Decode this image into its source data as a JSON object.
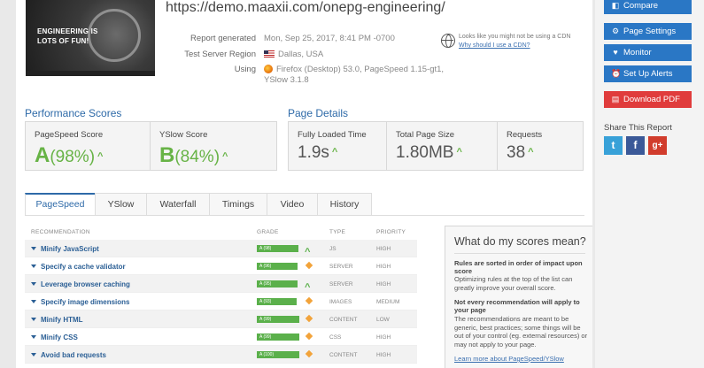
{
  "report": {
    "url": "https://demo.maaxii.com/onepg-engineering/",
    "thumbnail_text": "ENGINEERING IS LOTS OF FUN!",
    "meta": [
      {
        "label": "Report generated",
        "value": "Mon, Sep 25, 2017, 8:41 PM -0700"
      },
      {
        "label": "Test Server Region",
        "value": "Dallas, USA"
      },
      {
        "label": "Using",
        "value": "Firefox (Desktop) 53.0, PageSpeed 1.15-gt1, YSlow 3.1.8"
      }
    ],
    "cdn_text": "Looks like you might not be using a CDN",
    "cdn_link": "Why should I use a CDN?"
  },
  "performance": {
    "title": "Performance Scores",
    "pagespeed": {
      "label": "PageSpeed Score",
      "grade": "A",
      "value": "(98%)"
    },
    "yslow": {
      "label": "YSlow Score",
      "grade": "B",
      "value": "(84%)"
    }
  },
  "details": {
    "title": "Page Details",
    "items": [
      {
        "label": "Fully Loaded Time",
        "value": "1.9s"
      },
      {
        "label": "Total Page Size",
        "value": "1.80MB"
      },
      {
        "label": "Requests",
        "value": "38"
      }
    ]
  },
  "tabs": [
    "PageSpeed",
    "YSlow",
    "Waterfall",
    "Timings",
    "Video",
    "History"
  ],
  "table": {
    "headers": {
      "recommendation": "RECOMMENDATION",
      "grade": "GRADE",
      "type": "TYPE",
      "priority": "PRIORITY"
    },
    "rows": [
      {
        "name": "Minify JavaScript",
        "grade": "A (98)",
        "fill": 98,
        "trend": "up",
        "type": "JS",
        "priority": "HIGH"
      },
      {
        "name": "Specify a cache validator",
        "grade": "A (96)",
        "fill": 96,
        "trend": "diamond",
        "type": "SERVER",
        "priority": "HIGH"
      },
      {
        "name": "Leverage browser caching",
        "grade": "A (95)",
        "fill": 95,
        "trend": "up",
        "type": "SERVER",
        "priority": "HIGH"
      },
      {
        "name": "Specify image dimensions",
        "grade": "A (93)",
        "fill": 93,
        "trend": "diamond",
        "type": "IMAGES",
        "priority": "MEDIUM"
      },
      {
        "name": "Minify HTML",
        "grade": "A (99)",
        "fill": 99,
        "trend": "diamond",
        "type": "CONTENT",
        "priority": "LOW"
      },
      {
        "name": "Minify CSS",
        "grade": "A (99)",
        "fill": 99,
        "trend": "diamond",
        "type": "CSS",
        "priority": "HIGH"
      },
      {
        "name": "Avoid bad requests",
        "grade": "A (100)",
        "fill": 100,
        "trend": "diamond",
        "type": "CONTENT",
        "priority": "HIGH"
      }
    ]
  },
  "info_panel": {
    "title": "What do my scores mean?",
    "block1_title": "Rules are sorted in order of impact upon score",
    "block1_text": "Optimizing rules at the top of the list can greatly improve your overall score.",
    "block2_title": "Not every recommendation will apply to your page",
    "block2_text": "The recommendations are meant to be generic, best practices; some things will be out of your control (eg. external resources) or may not apply to your page.",
    "link": "Learn more about PageSpeed/YSlow"
  },
  "sidebar": {
    "buttons": [
      {
        "label": "Compare",
        "icon": "compare-icon",
        "glyph": "◧",
        "style": "blue"
      },
      {
        "label": "Page Settings",
        "icon": "gear-icon",
        "glyph": "⚙",
        "style": "blue"
      },
      {
        "label": "Monitor",
        "icon": "pulse-icon",
        "glyph": "♥",
        "style": "blue"
      },
      {
        "label": "Set Up Alerts",
        "icon": "alarm-icon",
        "glyph": "⏰",
        "style": "blue"
      },
      {
        "label": "Download PDF",
        "icon": "pdf-icon",
        "glyph": "▤",
        "style": "red"
      }
    ],
    "share_title": "Share This Report",
    "social": [
      {
        "name": "twitter",
        "glyph": "t"
      },
      {
        "name": "facebook",
        "glyph": "f"
      },
      {
        "name": "google-plus",
        "glyph": "g+"
      }
    ]
  },
  "colors": {
    "accent": "#2e6aa8",
    "good": "#67b346",
    "button": "#2a77c5",
    "pdf": "#e03c3c"
  }
}
